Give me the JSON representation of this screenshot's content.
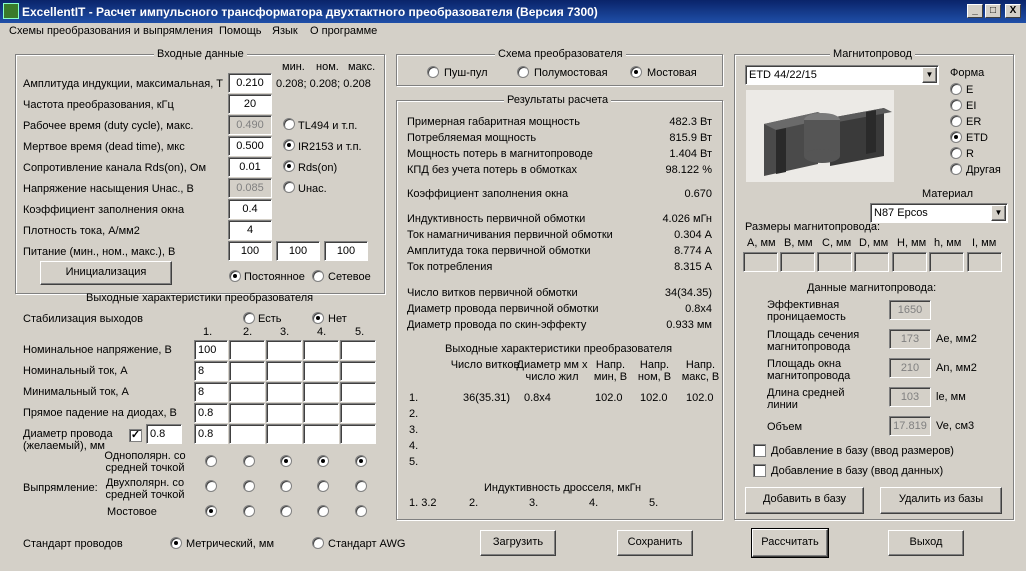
{
  "title": "ExcellentIT - Расчет импульсного трансформатора двухтактного преобразователя (Версия 7300)",
  "window_buttons": {
    "minimize": "_",
    "maximize": "□",
    "close": "X"
  },
  "menu": [
    "Схемы преобразования и выпрямления",
    "Помощь",
    "Язык",
    "О программе"
  ],
  "input": {
    "group": "Входные данные",
    "hdr": {
      "min": "мин.",
      "nom": "ном.",
      "max": "макс."
    },
    "induction": {
      "label": "Амплитуда индукции, максимальная, Т",
      "value": "0.210",
      "range": "0.208; 0.208; 0.208"
    },
    "freq": {
      "label": "Частота преобразования, кГц",
      "value": "20"
    },
    "duty": {
      "label": "Рабочее время (duty cycle), макс.",
      "value": "0.490"
    },
    "dead": {
      "label": "Мертвое время (dead time), мкс",
      "value": "0.500"
    },
    "rds": {
      "label": "Сопротивление канала Rds(on), Ом",
      "value": "0.01"
    },
    "usat": {
      "label": "Напряжение насыщения Uнас., В",
      "value": "0.085"
    },
    "fill": {
      "label": "Коэффициент заполнения окна",
      "value": "0.4"
    },
    "jdens": {
      "label": "Плотность тока, А/мм2",
      "value": "4"
    },
    "supply": {
      "label": "Питание (мин., ном., макс.), В",
      "min": "100",
      "nom": "100",
      "max": "100"
    },
    "opt_tl494": "TL494 и т.п.",
    "opt_ir2153": "IR2153 и т.п.",
    "opt_rds": "Rds(on)",
    "opt_unas": "Uнас.",
    "init_btn": "Инициализация",
    "opt_const": "Постоянное",
    "opt_net": "Сетевое"
  },
  "output": {
    "group": "Выходные характеристики преобразователя",
    "stab": "Стабилизация выходов",
    "opt_yes": "Есть",
    "opt_no": "Нет",
    "cols": [
      "1.",
      "2.",
      "3.",
      "4.",
      "5."
    ],
    "nom_v": {
      "label": "Номинальное напряжение, В",
      "v1": "100"
    },
    "nom_i": {
      "label": "Номинальный ток, А",
      "v1": "8"
    },
    "min_i": {
      "label": "Минимальный ток, А",
      "v1": "8"
    },
    "drop": {
      "label": "Прямое падение на диодах, В",
      "v1": "0.8"
    },
    "wire": {
      "label": "Диаметр провода (желаемый), мм",
      "val": "0.8",
      "v1": "0.8",
      "checked": "✓"
    },
    "rect_label": "Выпрямление:",
    "rect1": "Однополярн. со средней точкой",
    "rect2": "Двухполярн. со средней точкой",
    "rect3": "Мостовое"
  },
  "wire_std": {
    "label": "Стандарт проводов",
    "metric": "Метрический, мм",
    "awg": "Стандарт AWG"
  },
  "scheme": {
    "group": "Схема преобразователя",
    "pp": "Пуш-пул",
    "half": "Полумостовая",
    "bridge": "Мостовая"
  },
  "results": {
    "group": "Результаты расчета",
    "rows": [
      {
        "label": "Примерная габаритная мощность",
        "value": "482.3 Вт"
      },
      {
        "label": "Потребляемая мощность",
        "value": "815.9 Вт"
      },
      {
        "label": "Мощность потерь в магнитопроводе",
        "value": "1.404 Вт"
      },
      {
        "label": "КПД без учета потерь в обмотках",
        "value": "98.122 %"
      },
      {
        "label": "Коэффициент заполнения окна",
        "value": "0.670"
      },
      {
        "label": "Индуктивность первичной обмотки",
        "value": "4.026 мГн"
      },
      {
        "label": "Ток намагничивания первичной обмотки",
        "value": "0.304 А"
      },
      {
        "label": "Амплитуда тока первичной обмотки",
        "value": "8.774 А"
      },
      {
        "label": "Ток потребления",
        "value": "8.315 А"
      },
      {
        "label": "Число витков первичной обмотки",
        "value": "34(34.35)"
      },
      {
        "label": "Диаметр провода первичной обмотки",
        "value": "0.8x4"
      },
      {
        "label": "Диаметр провода по скин-эффекту",
        "value": "0.933 мм"
      }
    ],
    "out_title": "Выходные характеристики преобразователя",
    "out_hdr": [
      "Число витков",
      "Диаметр мм х число жил",
      "Напр. мин, В",
      "Напр. ном, В",
      "Напр. макс, В"
    ],
    "out_rows": [
      {
        "n": "1.",
        "turns": "36(35.31)",
        "dia": "0.8x4",
        "vmin": "102.0",
        "vnom": "102.0",
        "vmax": "102.0"
      },
      {
        "n": "2."
      },
      {
        "n": "3."
      },
      {
        "n": "4."
      },
      {
        "n": "5."
      }
    ],
    "ind_title": "Индуктивность дросселя, мкГн",
    "ind": [
      "1. 3.2",
      "2.",
      "3.",
      "4.",
      "5."
    ]
  },
  "core": {
    "group": "Магнитопровод",
    "selected": "ETD 44/22/15",
    "shape_label": "Форма",
    "shapes": [
      "E",
      "EI",
      "ER",
      "ETD",
      "R",
      "Другая"
    ],
    "material_label": "Материал",
    "material": "N87 Epcos",
    "dims_label": "Размеры магнитопровода:",
    "dims": [
      "A, мм",
      "B, мм",
      "C, мм",
      "D, мм",
      "H, мм",
      "h, мм",
      "I, мм"
    ],
    "data_label": "Данные магнитопровода:",
    "mu": {
      "label": "Эффективная проницаемость",
      "value": "1650"
    },
    "ae": {
      "label": "Площадь сечения магнитопровода",
      "value": "173",
      "unit": "Ae, мм2"
    },
    "an": {
      "label": "Площадь окна магнитопровода",
      "value": "210",
      "unit": "An, мм2"
    },
    "le": {
      "label": "Длина средней линии",
      "value": "103",
      "unit": "le, мм"
    },
    "ve": {
      "label": "Объем",
      "value": "17.819",
      "unit": "Ve, см3"
    },
    "add_dims": "Добавление в базу (ввод размеров)",
    "add_data": "Добавление в базу (ввод данных)",
    "add_btn": "Добавить в базу",
    "del_btn": "Удалить из базы"
  },
  "buttons": {
    "load": "Загрузить",
    "save": "Сохранить",
    "calc": "Рассчитать",
    "exit": "Выход"
  }
}
